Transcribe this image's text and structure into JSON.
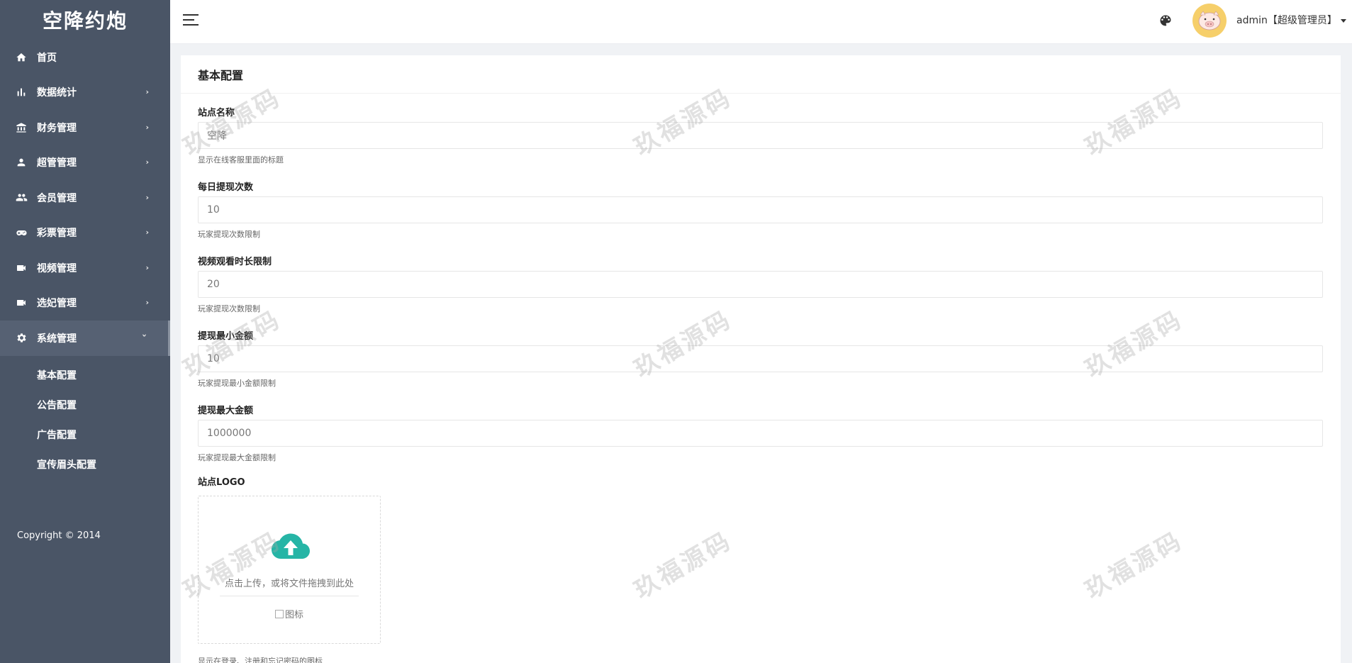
{
  "sidebar": {
    "brand": "空降约炮",
    "items": [
      {
        "label": "首页",
        "icon": "home-icon",
        "has_chevron": false
      },
      {
        "label": "数据统计",
        "icon": "bar-chart-icon",
        "has_chevron": true
      },
      {
        "label": "财务管理",
        "icon": "bank-icon",
        "has_chevron": true
      },
      {
        "label": "超管管理",
        "icon": "user-icon",
        "has_chevron": true
      },
      {
        "label": "会员管理",
        "icon": "users-icon",
        "has_chevron": true
      },
      {
        "label": "彩票管理",
        "icon": "gamepad-icon",
        "has_chevron": true
      },
      {
        "label": "视频管理",
        "icon": "video-camera-icon",
        "has_chevron": true
      },
      {
        "label": "选妃管理",
        "icon": "video-camera-icon",
        "has_chevron": true
      },
      {
        "label": "系统管理",
        "icon": "gear-icon",
        "has_chevron": true,
        "expanded": true
      }
    ],
    "submenu": [
      "基本配置",
      "公告配置",
      "广告配置",
      "宣传眉头配置"
    ],
    "copyright": "Copyright © 2014"
  },
  "header": {
    "user_label": "admin【超级管理员】"
  },
  "card": {
    "title": "基本配置",
    "fields": [
      {
        "label": "站点名称",
        "value": "空降",
        "help": "显示在线客服里面的标题"
      },
      {
        "label": "每日提现次数",
        "value": "10",
        "help": "玩家提现次数限制"
      },
      {
        "label": "视频观看时长限制",
        "value": "20",
        "help": "玩家提现次数限制"
      },
      {
        "label": "提现最小金额",
        "value": "10",
        "help": "玩家提现最小金额限制"
      },
      {
        "label": "提现最大金额",
        "value": "1000000",
        "help": "玩家提现最大金额限制"
      }
    ],
    "logo": {
      "label": "站点LOGO",
      "upload_hint": "点击上传，或将文件拖拽到此处",
      "image_alt": "图标",
      "help": "显示在登录、注册和忘记密码的图标"
    }
  },
  "watermark": "玖福源码",
  "colors": {
    "sidebar_bg": "#4a5566",
    "upload_icon": "#26b5a6",
    "avatar_bg": "#f6cf6a"
  }
}
